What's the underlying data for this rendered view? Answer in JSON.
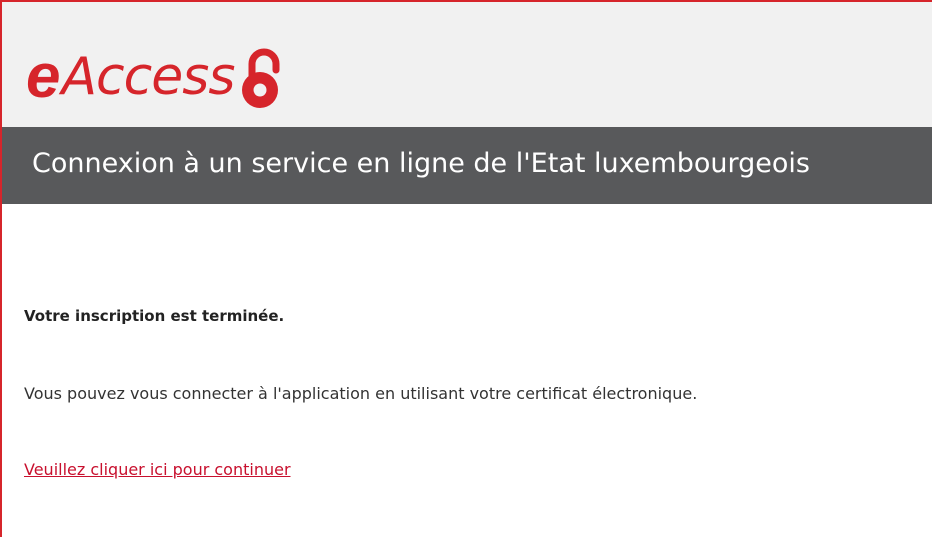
{
  "logo": {
    "prefix": "e",
    "name": "Access",
    "icon": "padlock-icon",
    "color": "#d6252b"
  },
  "header": {
    "title": "Connexion à un service en ligne de l'Etat luxembourgeois",
    "background": "#58595b"
  },
  "main": {
    "heading": "Votre inscription est terminée.",
    "message": "Vous pouvez vous connecter à l'application en utilisant votre certificat électronique.",
    "continue_link": "Veuillez cliquer ici pour continuer"
  }
}
